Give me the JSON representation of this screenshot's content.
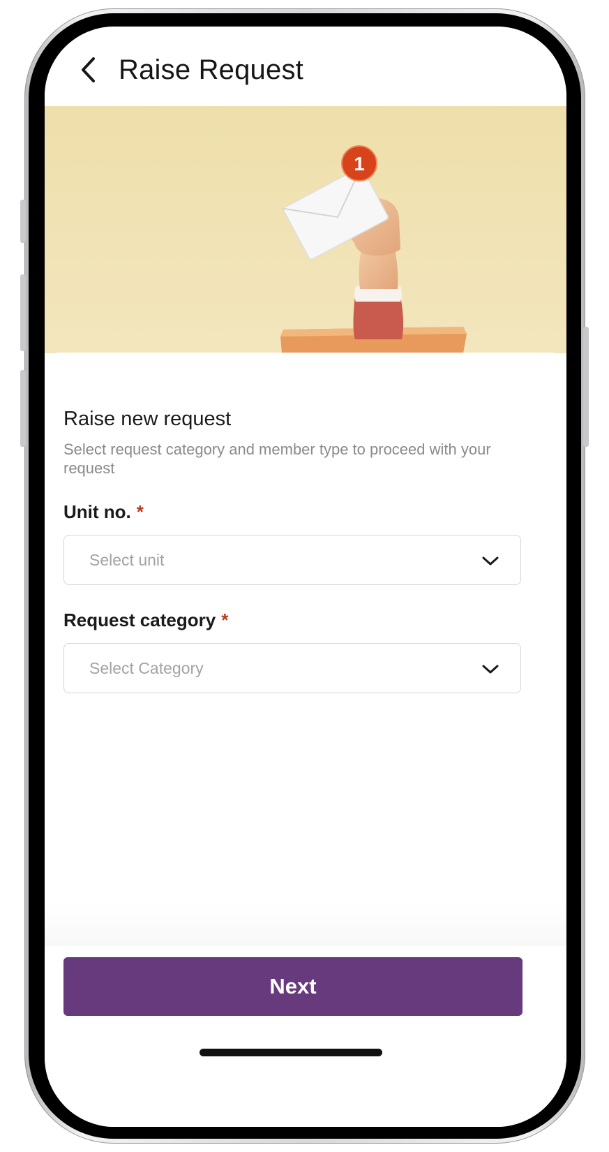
{
  "header": {
    "title": "Raise Request",
    "back_icon": "chevron-left-icon"
  },
  "hero": {
    "image": "hand-holding-envelope-illustration",
    "badge_count": "1",
    "colors": {
      "background": "#f0e2b2",
      "badge": "#d9431c",
      "sleeve": "#c85a4e"
    }
  },
  "form": {
    "title": "Raise new request",
    "description": "Select request category and member type to proceed with your request",
    "fields": [
      {
        "label": "Unit no.",
        "required_mark": "*",
        "placeholder": "Select unit",
        "icon": "chevron-down-icon"
      },
      {
        "label": "Request category",
        "required_mark": "*",
        "placeholder": "Select Category",
        "icon": "chevron-down-icon"
      }
    ]
  },
  "footer": {
    "next_label": "Next"
  },
  "colors": {
    "primary": "#663a7c",
    "required": "#b83a1e",
    "placeholder": "#a3a3a3",
    "border": "#d6d6d6"
  }
}
